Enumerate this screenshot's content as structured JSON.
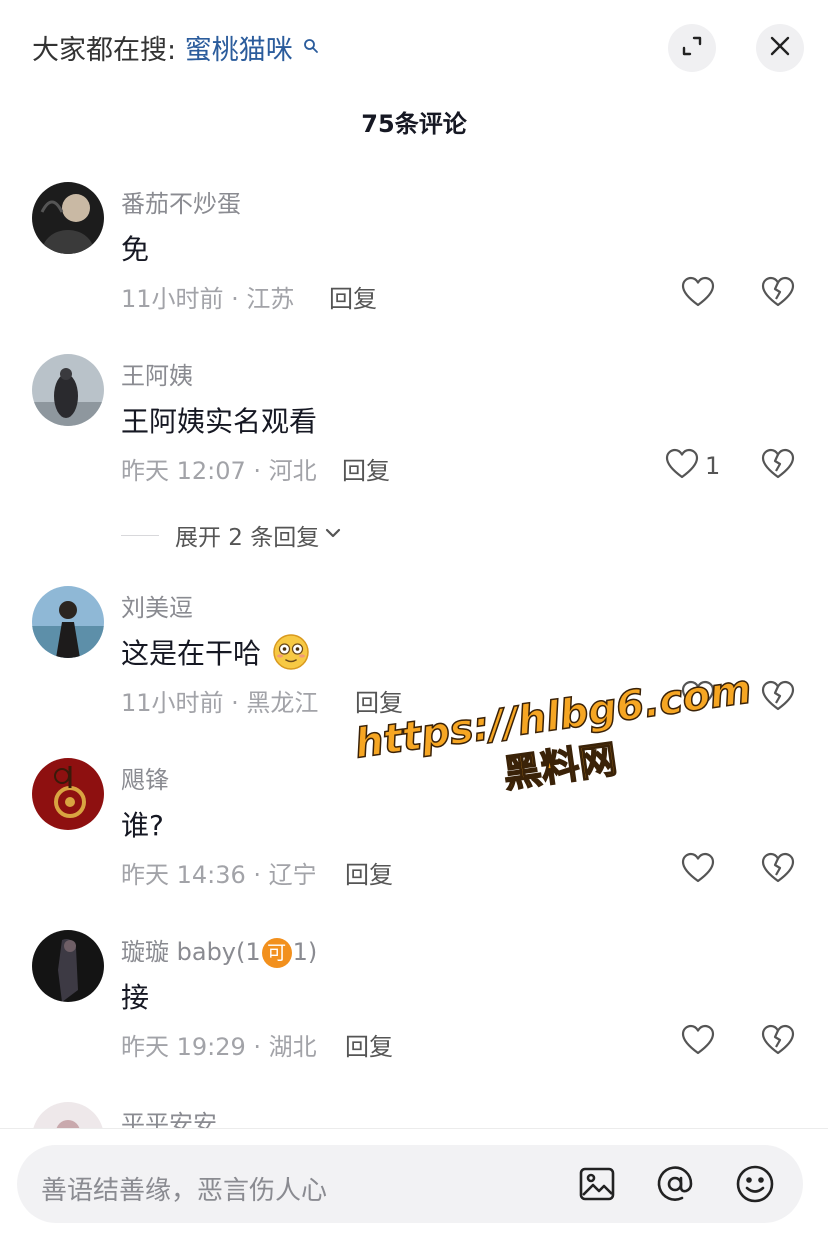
{
  "search_hint": {
    "prefix": "大家都在搜:",
    "keyword": "蜜桃猫咪"
  },
  "title": "75条评论",
  "comments": [
    {
      "name": "番茄不炒蛋",
      "text": "免",
      "time": "11小时前 · 江苏",
      "reply": "回复",
      "likes": ""
    },
    {
      "name": "王阿姨",
      "text": "王阿姨实名观看",
      "time": "昨天 12:07 · 河北",
      "reply": "回复",
      "likes": "1"
    },
    {
      "name": "刘美逗",
      "text": "这是在干哈",
      "time": "11小时前 · 黑龙江",
      "reply": "回复",
      "likes": ""
    },
    {
      "name": "飓锋",
      "text": "谁?",
      "time": "昨天 14:36 · 辽宁",
      "reply": "回复",
      "likes": ""
    },
    {
      "name_prefix": "璇璇 baby(1",
      "name_badge": "可",
      "name_suffix": "1)",
      "text": "接",
      "time": "昨天 19:29 · 湖北",
      "reply": "回复",
      "likes": ""
    },
    {
      "name": "平平安安"
    }
  ],
  "expand_replies": "展开 2 条回复",
  "watermark": {
    "url": "https://hlbg6.com",
    "name": "黑料网"
  },
  "input": {
    "placeholder": "善语结善缘，恶言伤人心"
  },
  "icons": [
    "search-icon",
    "collapse-icon",
    "close-icon",
    "heart-icon",
    "broken-heart-icon",
    "chevron-down-icon",
    "image-icon",
    "at-icon",
    "emoji-icon"
  ],
  "colors": {
    "keyword": "#2b5c9c",
    "watermark": "#f6a623",
    "meta": "#a2a3a8"
  }
}
